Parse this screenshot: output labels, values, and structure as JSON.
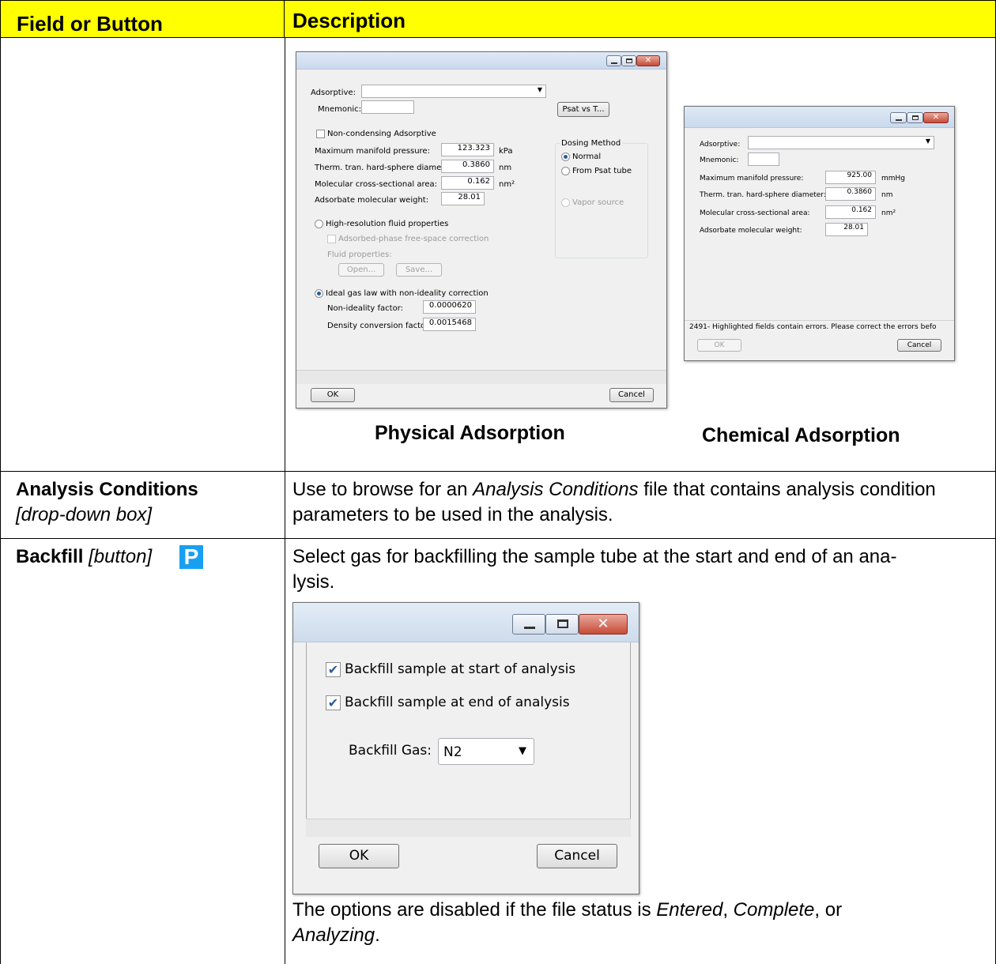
{
  "table": {
    "header_left": "Field or Button",
    "header_right": "Description"
  },
  "physical_dialog": {
    "adsorptive_label": "Adsorptive:",
    "adsorptive_value": "",
    "mnemonic_label": "Mnemonic:",
    "mnemonic_value": "",
    "psat_button": "Psat vs T...",
    "noncondensing_label": "Non-condensing Adsorptive",
    "max_pressure_label": "Maximum manifold pressure:",
    "max_pressure_value": "123.323",
    "max_pressure_unit": "kPa",
    "diameter_label": "Therm. tran. hard-sphere diameter:",
    "diameter_value": "0.3860",
    "diameter_unit": "nm",
    "area_label": "Molecular cross-sectional area:",
    "area_value": "0.162",
    "area_unit": "nm²",
    "weight_label": "Adsorbate molecular weight:",
    "weight_value": "28.01",
    "dosing_title": "Dosing Method",
    "dosing_normal": "Normal",
    "dosing_psat": "From Psat tube",
    "dosing_vapor": "Vapor source",
    "highres_label": "High-resolution fluid properties",
    "freespace_label": "Adsorbed-phase free-space correction",
    "fluid_props_label": "Fluid properties:",
    "open_button": "Open...",
    "save_button": "Save...",
    "ideal_label": "Ideal gas law with non-ideality correction",
    "nonideality_label": "Non-ideality factor:",
    "nonideality_value": "0.0000620",
    "density_label": "Density conversion factor:",
    "density_value": "0.0015468",
    "ok_button": "OK",
    "cancel_button": "Cancel",
    "caption": "Physical Adsorption"
  },
  "chemical_dialog": {
    "adsorptive_label": "Adsorptive:",
    "adsorptive_value": "",
    "mnemonic_label": "Mnemonic:",
    "mnemonic_value": "",
    "max_pressure_label": "Maximum manifold pressure:",
    "max_pressure_value": "925.00",
    "max_pressure_unit": "mmHg",
    "diameter_label": "Therm. tran. hard-sphere diameter:",
    "diameter_value": "0.3860",
    "diameter_unit": "nm",
    "area_label": "Molecular cross-sectional area:",
    "area_value": "0.162",
    "area_unit": "nm²",
    "weight_label": "Adsorbate molecular weight:",
    "weight_value": "28.01",
    "error_text": "2491- Highlighted fields contain errors. Please correct the errors befo",
    "ok_button": "OK",
    "cancel_button": "Cancel",
    "caption": "Chemical Adsorption"
  },
  "rows": {
    "analysis_conditions": {
      "name": "Analysis Conditions",
      "type": "[drop-down box]",
      "desc_pre": "Use to browse for an ",
      "desc_italic": "Analysis Conditions",
      "desc_post": " file that contains analysis condition parameters to be used in the analysis."
    },
    "backfill": {
      "name": "Backfill",
      "type": "[button]",
      "p_icon": "P",
      "desc_line1": "Select gas for backfilling the sample tube at the start and end of an ana-",
      "desc_line2": "lysis.",
      "note_pre": "The options are disabled if the file status is ",
      "note_entered": "Entered",
      "note_comma": ", ",
      "note_complete": "Complete",
      "note_or": ", or",
      "note_analyzing": "Analyzing",
      "note_end": "."
    }
  },
  "backfill_dialog": {
    "start_label": "Backfill sample at start of analysis",
    "end_label": "Backfill sample at end of analysis",
    "gas_label": "Backfill Gas:",
    "gas_value": "N2",
    "ok_button": "OK",
    "cancel_button": "Cancel"
  }
}
